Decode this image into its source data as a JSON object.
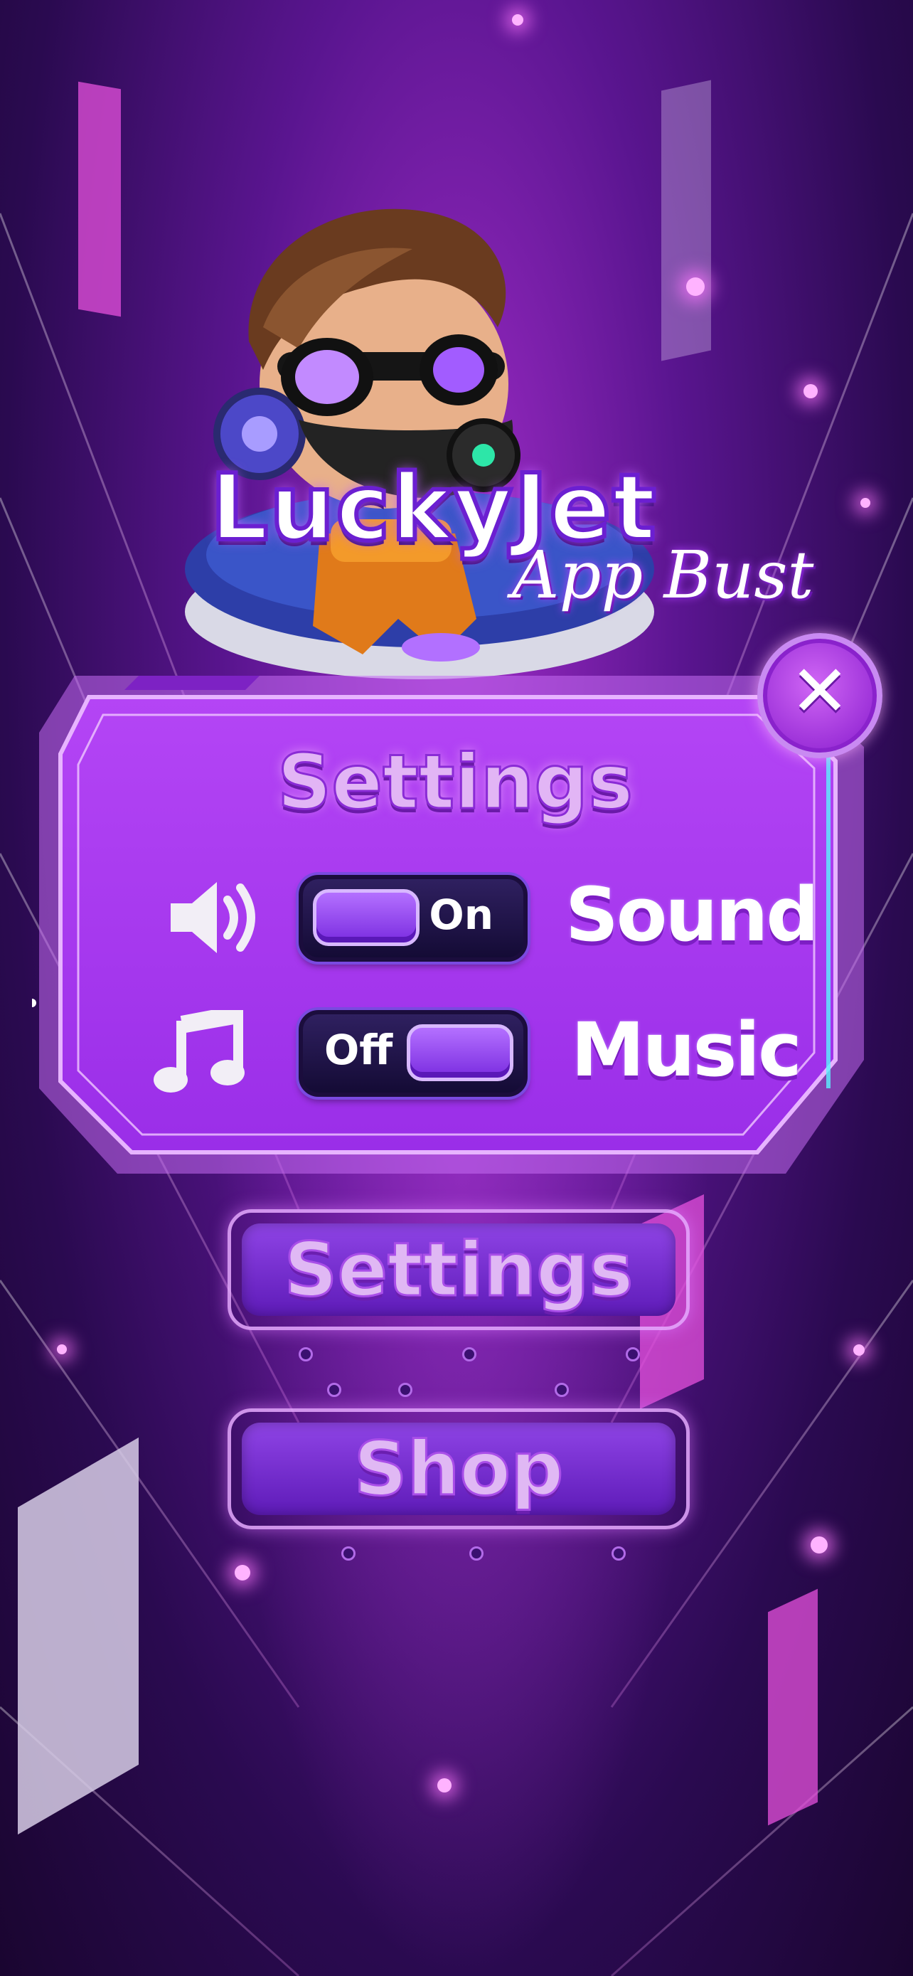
{
  "app": {
    "logo_main": "LuckyJet",
    "logo_sub": "App Bust"
  },
  "modal": {
    "title": "Settings",
    "close_icon": "close-icon",
    "rows": [
      {
        "icon": "speaker-icon",
        "toggle_label": "On",
        "toggle_state": "on",
        "label": "Sound"
      },
      {
        "icon": "music-note-icon",
        "toggle_label": "Off",
        "toggle_state": "off",
        "label": "Music"
      }
    ]
  },
  "menu": {
    "settings_label": "Settings",
    "shop_label": "Shop"
  },
  "colors": {
    "accent": "#9b30d8",
    "panel": "#a336f0",
    "text": "#ffffff"
  }
}
